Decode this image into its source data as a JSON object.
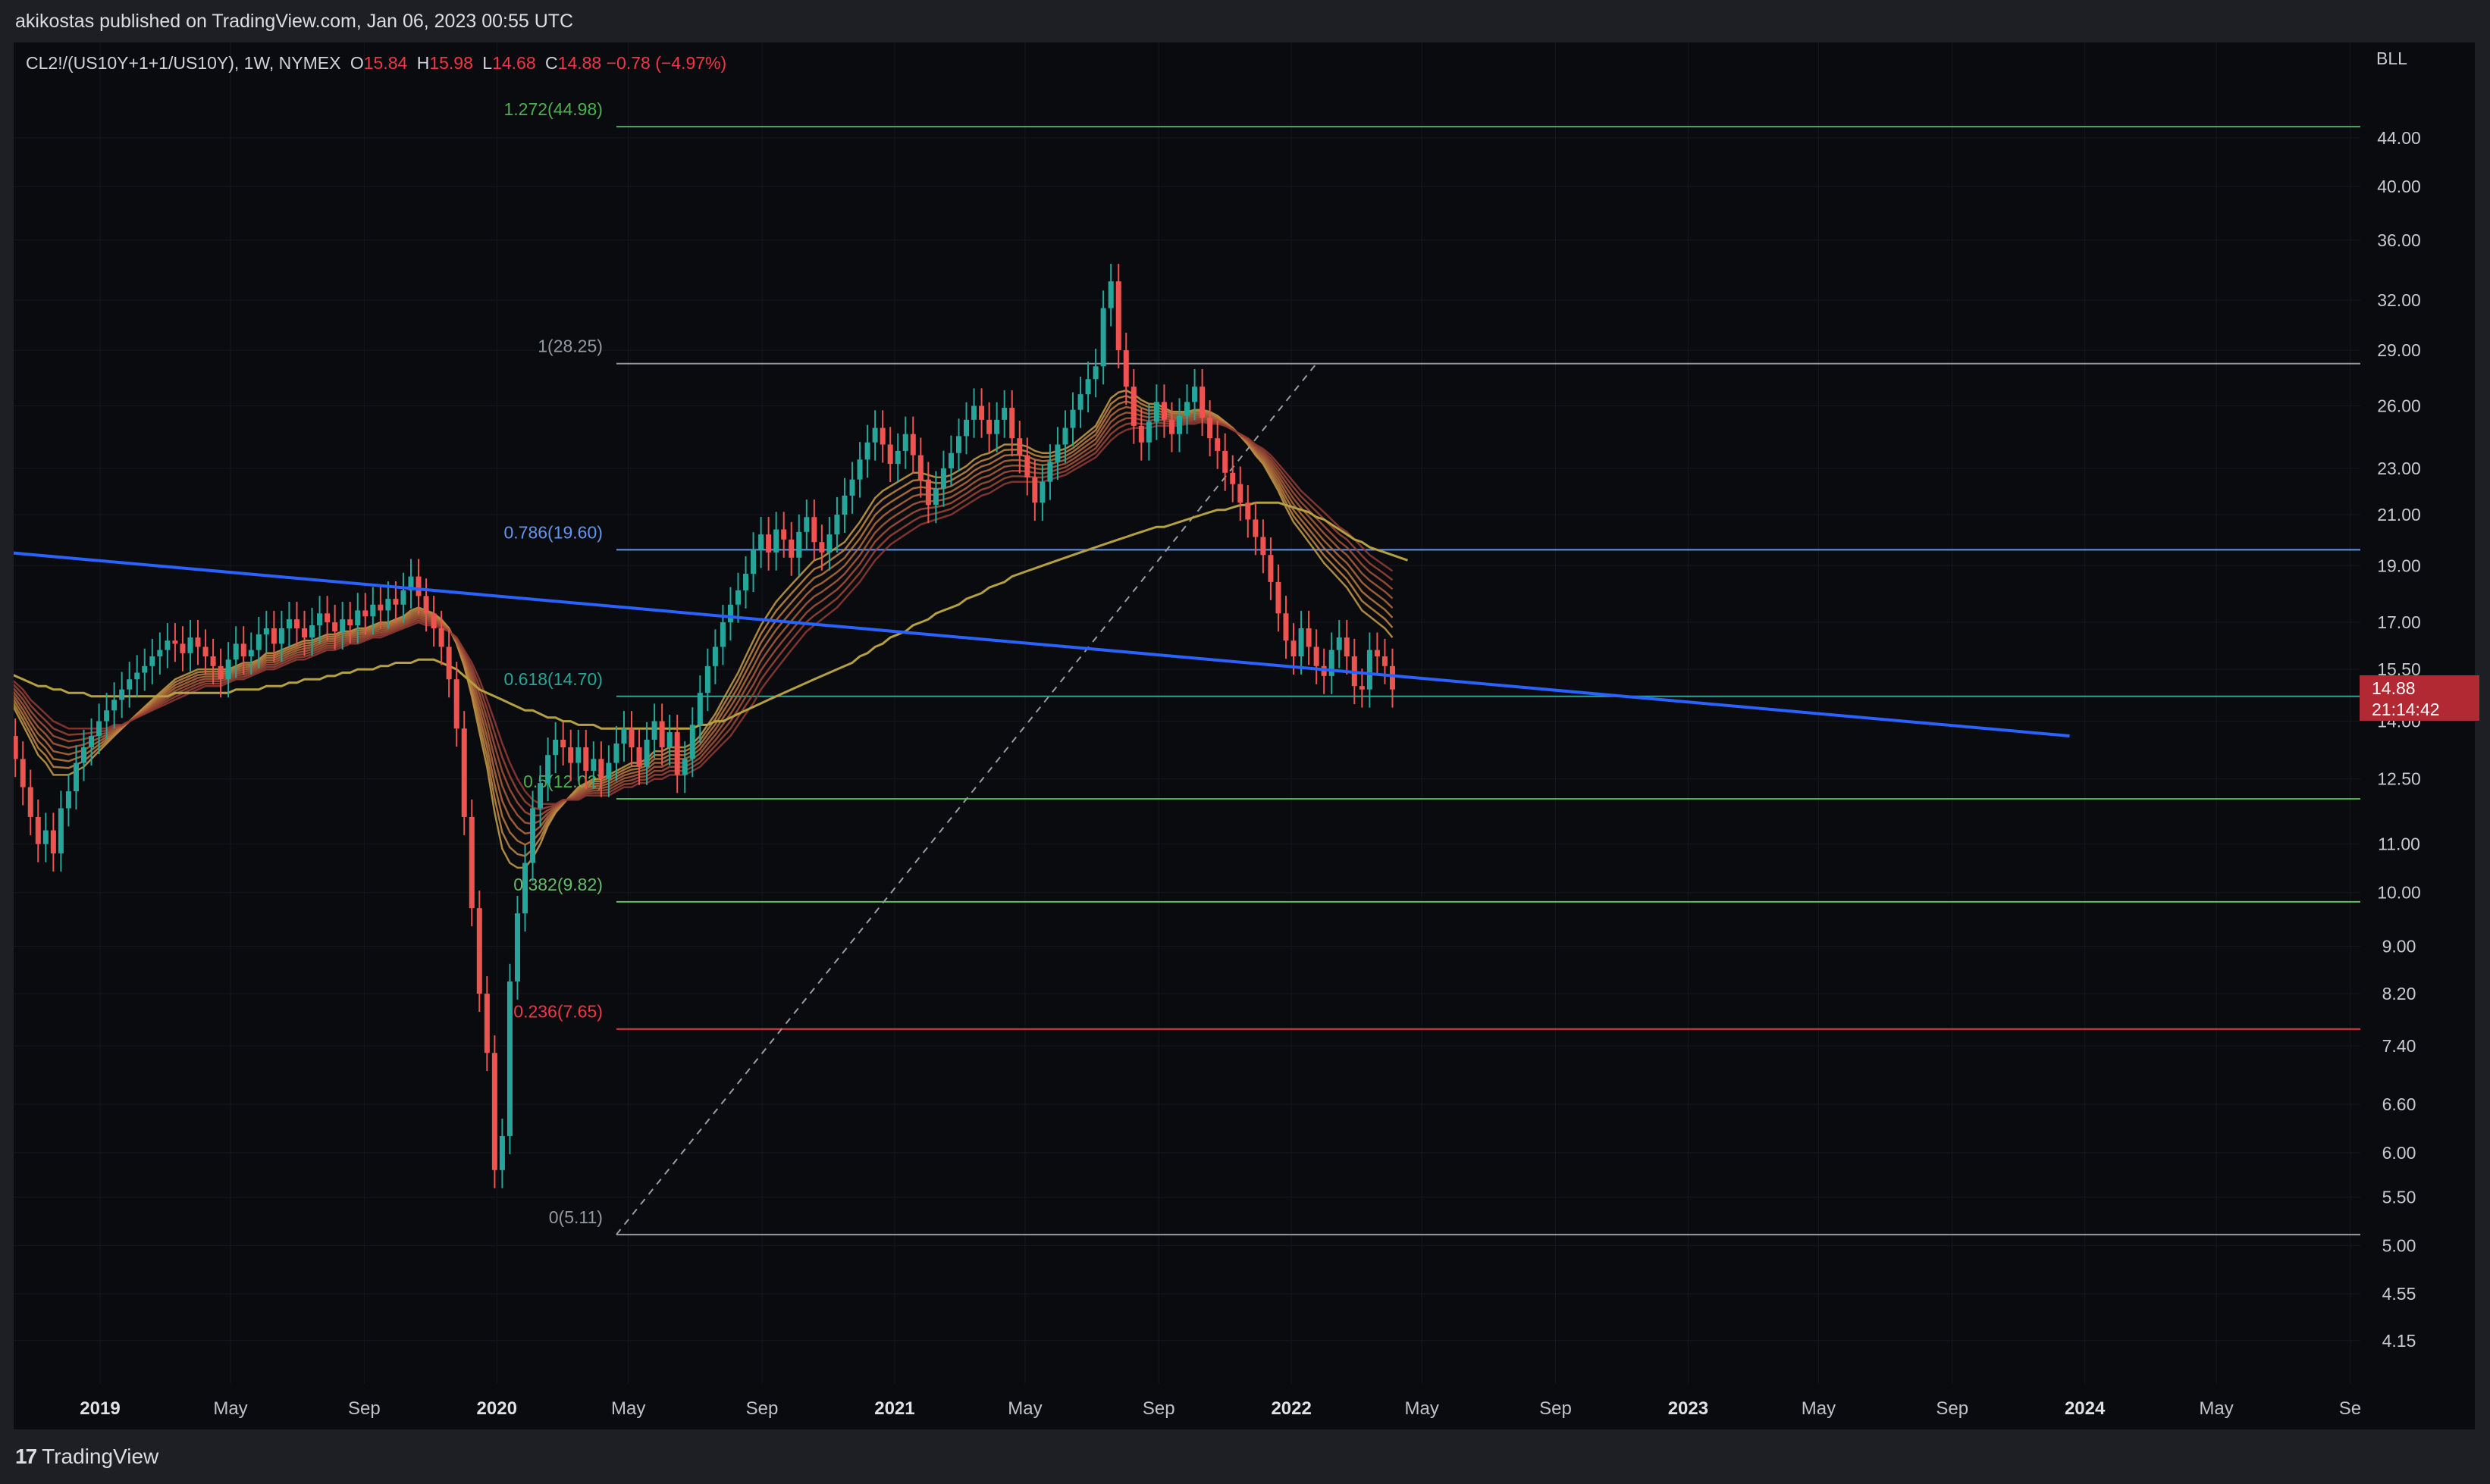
{
  "header": {
    "publisher_text": "akikostas published on TradingView.com, Jan 06, 2023 00:55 UTC"
  },
  "legend": {
    "symbol": "CL2!/(US10Y+1+1/US10Y), 1W, NYMEX",
    "o_label": "O",
    "o_value": "15.84",
    "h_label": "H",
    "h_value": "15.98",
    "l_label": "L",
    "l_value": "14.68",
    "c_label": "C",
    "c_value": "14.88",
    "change": "−0.78 (−4.97%)"
  },
  "currency_label": "BLL",
  "price_box": {
    "price": "14.88",
    "countdown": "21:14:42"
  },
  "footer": {
    "logo_mark": "17",
    "logo_text": "TradingView"
  },
  "colors": {
    "background": "#0a0b0f",
    "up": "#26a69a",
    "down": "#ef5350",
    "trendline": "#2962ff",
    "fib_green": "#4caf50",
    "fib_red": "#f23645",
    "fib_blue": "#6495ed",
    "fib_gray": "#9598a1"
  },
  "chart_data": {
    "type": "candlestick",
    "y_scale": "log",
    "ylim": [
      3.8,
      50
    ],
    "y_ticks": [
      "44.00",
      "40.00",
      "36.00",
      "32.00",
      "29.00",
      "26.00",
      "23.00",
      "21.00",
      "19.00",
      "17.00",
      "15.50",
      "14.00",
      "12.50",
      "11.00",
      "10.00",
      "9.00",
      "8.20",
      "7.40",
      "6.60",
      "6.00",
      "5.50",
      "5.00",
      "4.55",
      "4.15"
    ],
    "x_ticks": [
      {
        "label": "2019",
        "date": "2019-01-01",
        "bold": true
      },
      {
        "label": "May",
        "date": "2019-05-01",
        "bold": false
      },
      {
        "label": "Sep",
        "date": "2019-09-01",
        "bold": false
      },
      {
        "label": "2020",
        "date": "2020-01-01",
        "bold": true
      },
      {
        "label": "May",
        "date": "2020-05-01",
        "bold": false
      },
      {
        "label": "Sep",
        "date": "2020-09-01",
        "bold": false
      },
      {
        "label": "2021",
        "date": "2021-01-01",
        "bold": true
      },
      {
        "label": "May",
        "date": "2021-05-01",
        "bold": false
      },
      {
        "label": "Sep",
        "date": "2021-09-01",
        "bold": false
      },
      {
        "label": "2022",
        "date": "2022-01-01",
        "bold": true
      },
      {
        "label": "May",
        "date": "2022-05-01",
        "bold": false
      },
      {
        "label": "Sep",
        "date": "2022-09-01",
        "bold": false
      },
      {
        "label": "2023",
        "date": "2023-01-01",
        "bold": true
      },
      {
        "label": "May",
        "date": "2023-05-01",
        "bold": false
      },
      {
        "label": "Sep",
        "date": "2023-09-01",
        "bold": false
      },
      {
        "label": "2024",
        "date": "2024-01-01",
        "bold": true
      },
      {
        "label": "May",
        "date": "2024-05-01",
        "bold": false
      },
      {
        "label": "Se",
        "date": "2024-09-01",
        "bold": false
      }
    ],
    "fib_levels": [
      {
        "label": "1.272(44.98)",
        "value": 44.98,
        "color": "#4caf50"
      },
      {
        "label": "1(28.25)",
        "value": 28.25,
        "color": "#9598a1"
      },
      {
        "label": "0.786(19.60)",
        "value": 19.6,
        "color": "#6495ed"
      },
      {
        "label": "0.618(14.70)",
        "value": 14.7,
        "color": "#26a69a"
      },
      {
        "label": "0.5(12.02)",
        "value": 12.02,
        "color": "#4caf50"
      },
      {
        "label": "0.382(9.82)",
        "value": 9.82,
        "color": "#66bb6a"
      },
      {
        "label": "0.236(7.65)",
        "value": 7.65,
        "color": "#f23645"
      },
      {
        "label": "0(5.11)",
        "value": 5.11,
        "color": "#9598a1"
      }
    ],
    "fib_start_date": "2020-04-20",
    "fib_end_date": "2024-12-20",
    "fib_diagonal": {
      "from": {
        "date": "2020-04-20",
        "value": 5.11
      },
      "to": {
        "date": "2022-01-24",
        "value": 28.25
      }
    },
    "trendline": {
      "from": {
        "date": "2018-09-10",
        "value": 19.6
      },
      "to": {
        "date": "2023-12-18",
        "value": 13.6
      }
    },
    "candles": {
      "start_date": "2018-09-17",
      "close": [
        15.9,
        15.5,
        14.9,
        13.6,
        13.0,
        12.3,
        11.6,
        11.0,
        11.3,
        10.8,
        11.8,
        12.2,
        12.9,
        13.3,
        13.6,
        14.0,
        14.3,
        14.6,
        14.9,
        15.2,
        15.4,
        15.6,
        15.9,
        16.1,
        16.4,
        16.3,
        16.0,
        16.5,
        16.2,
        15.9,
        15.6,
        15.2,
        15.8,
        16.3,
        15.9,
        16.1,
        16.6,
        16.8,
        16.3,
        16.8,
        17.1,
        16.8,
        16.5,
        16.9,
        17.3,
        17.0,
        16.7,
        17.1,
        16.9,
        17.4,
        17.2,
        17.6,
        17.4,
        17.8,
        17.6,
        18.1,
        18.6,
        17.9,
        17.3,
        16.8,
        16.2,
        15.2,
        13.8,
        11.6,
        9.7,
        8.2,
        7.3,
        5.8,
        6.2,
        8.4,
        9.6,
        10.6,
        11.8,
        12.4,
        13.1,
        13.5,
        13.3,
        12.9,
        13.3,
        12.7,
        13.0,
        12.5,
        12.9,
        13.4,
        13.8,
        13.3,
        12.8,
        13.5,
        14.0,
        13.3,
        13.7,
        12.6,
        13.0,
        13.9,
        14.8,
        15.6,
        16.2,
        17.0,
        17.6,
        18.1,
        18.7,
        19.6,
        20.2,
        19.5,
        20.4,
        20.0,
        19.3,
        20.3,
        20.9,
        19.9,
        19.5,
        20.2,
        21.0,
        21.8,
        22.5,
        23.4,
        24.2,
        24.9,
        24.1,
        23.2,
        23.8,
        24.6,
        23.6,
        22.5,
        21.4,
        22.1,
        23.0,
        23.7,
        24.5,
        25.3,
        26.0,
        25.3,
        24.6,
        25.3,
        25.9,
        24.4,
        23.6,
        22.6,
        21.5,
        22.4,
        23.3,
        24.1,
        24.9,
        25.8,
        26.6,
        27.4,
        28.1,
        31.5,
        33.2,
        29.0,
        27.0,
        25.0,
        24.2,
        25.2,
        26.2,
        25.3,
        24.6,
        25.5,
        26.2,
        27.0,
        25.4,
        24.4,
        23.8,
        22.8,
        22.3,
        21.5,
        20.8,
        20.1,
        19.4,
        18.4,
        17.3,
        16.4,
        15.9,
        16.8,
        16.2,
        15.6,
        15.3,
        16.1,
        16.5,
        15.9,
        15.0,
        14.9,
        16.1,
        15.9,
        15.6,
        14.9
      ],
      "ema_fast": [
        15.6,
        15.4,
        15.1,
        14.7,
        14.3,
        13.9,
        13.5,
        13.1,
        12.9,
        12.6,
        12.6,
        12.6,
        12.7,
        12.8,
        13.0,
        13.2,
        13.4,
        13.6,
        13.8,
        14.0,
        14.2,
        14.4,
        14.6,
        14.8,
        15.0,
        15.2,
        15.3,
        15.4,
        15.5,
        15.5,
        15.5,
        15.5,
        15.5,
        15.6,
        15.7,
        15.7,
        15.8,
        16.0,
        16.0,
        16.1,
        16.2,
        16.3,
        16.4,
        16.4,
        16.5,
        16.6,
        16.6,
        16.7,
        16.7,
        16.8,
        16.8,
        16.9,
        17.0,
        17.0,
        17.1,
        17.2,
        17.4,
        17.5,
        17.4,
        17.3,
        17.1,
        16.8,
        16.3,
        15.6,
        14.7,
        13.7,
        12.8,
        11.7,
        10.9,
        10.6,
        10.5,
        10.5,
        10.7,
        11.0,
        11.4,
        11.7,
        11.9,
        12.1,
        12.3,
        12.4,
        12.5,
        12.5,
        12.6,
        12.7,
        12.8,
        12.9,
        12.9,
        13.0,
        13.2,
        13.2,
        13.3,
        13.3,
        13.3,
        13.4,
        13.6,
        13.9,
        14.2,
        14.6,
        15.0,
        15.4,
        15.9,
        16.4,
        16.9,
        17.3,
        17.7,
        18.0,
        18.3,
        18.6,
        18.9,
        19.2,
        19.3,
        19.5,
        19.7,
        19.9,
        20.3,
        20.7,
        21.2,
        21.7,
        22.0,
        22.2,
        22.4,
        22.6,
        22.8,
        22.8,
        22.7,
        22.6,
        22.6,
        22.7,
        22.9,
        23.1,
        23.4,
        23.6,
        23.7,
        23.9,
        24.1,
        24.1,
        24.1,
        24.0,
        23.8,
        23.7,
        23.7,
        23.8,
        23.9,
        24.1,
        24.4,
        24.7,
        25.0,
        25.7,
        26.4,
        26.7,
        26.8,
        26.6,
        26.3,
        26.1,
        26.1,
        25.9,
        25.7,
        25.7,
        25.7,
        25.8,
        25.8,
        25.7,
        25.5,
        25.2,
        24.9,
        24.5,
        24.1,
        23.6,
        23.2,
        22.6,
        22.0,
        21.3,
        20.7,
        20.3,
        19.9,
        19.5,
        19.1,
        18.8,
        18.5,
        18.2,
        17.8,
        17.4,
        17.2,
        17.0,
        16.8,
        16.5
      ],
      "ema_slow": [
        15.8,
        15.7,
        15.5,
        15.3,
        15.1,
        14.9,
        14.6,
        14.4,
        14.2,
        14.0,
        13.9,
        13.8,
        13.8,
        13.8,
        13.8,
        13.8,
        13.8,
        13.9,
        13.9,
        14.0,
        14.1,
        14.2,
        14.3,
        14.4,
        14.5,
        14.6,
        14.7,
        14.8,
        14.9,
        15.0,
        15.0,
        15.0,
        15.1,
        15.2,
        15.2,
        15.3,
        15.4,
        15.5,
        15.5,
        15.6,
        15.7,
        15.8,
        15.8,
        15.9,
        16.0,
        16.1,
        16.1,
        16.2,
        16.3,
        16.3,
        16.4,
        16.5,
        16.5,
        16.6,
        16.7,
        16.8,
        16.9,
        17.0,
        16.9,
        16.9,
        16.8,
        16.7,
        16.5,
        16.1,
        15.7,
        15.2,
        14.6,
        14.0,
        13.4,
        12.9,
        12.5,
        12.2,
        12.0,
        11.9,
        11.9,
        11.9,
        12.0,
        12.0,
        12.0,
        12.1,
        12.1,
        12.1,
        12.1,
        12.2,
        12.3,
        12.3,
        12.4,
        12.4,
        12.5,
        12.5,
        12.6,
        12.6,
        12.6,
        12.7,
        12.8,
        13.0,
        13.2,
        13.4,
        13.6,
        13.9,
        14.2,
        14.5,
        14.9,
        15.2,
        15.5,
        15.8,
        16.1,
        16.4,
        16.7,
        16.9,
        17.1,
        17.3,
        17.5,
        17.8,
        18.1,
        18.4,
        18.8,
        19.2,
        19.5,
        19.8,
        20.0,
        20.2,
        20.4,
        20.6,
        20.7,
        20.8,
        20.9,
        21.0,
        21.2,
        21.4,
        21.6,
        21.8,
        21.9,
        22.1,
        22.3,
        22.4,
        22.4,
        22.4,
        22.4,
        22.4,
        22.5,
        22.6,
        22.7,
        22.9,
        23.1,
        23.3,
        23.5,
        23.9,
        24.3,
        24.6,
        24.8,
        24.9,
        24.9,
        24.9,
        25.0,
        25.0,
        25.0,
        25.0,
        25.1,
        25.1,
        25.2,
        25.1,
        25.1,
        25.0,
        24.8,
        24.6,
        24.4,
        24.1,
        23.9,
        23.6,
        23.2,
        22.8,
        22.4,
        22.0,
        21.7,
        21.4,
        21.1,
        20.8,
        20.5,
        20.3,
        20.0,
        19.7,
        19.4,
        19.2,
        19.0,
        18.8
      ],
      "ma_long": [
        15.7,
        15.6,
        15.5,
        15.4,
        15.3,
        15.2,
        15.1,
        15.0,
        15.0,
        14.9,
        14.9,
        14.8,
        14.8,
        14.8,
        14.7,
        14.7,
        14.7,
        14.7,
        14.7,
        14.7,
        14.7,
        14.7,
        14.7,
        14.7,
        14.7,
        14.8,
        14.8,
        14.8,
        14.8,
        14.8,
        14.8,
        14.8,
        14.8,
        14.9,
        14.9,
        14.9,
        14.9,
        15.0,
        15.0,
        15.0,
        15.1,
        15.1,
        15.2,
        15.2,
        15.2,
        15.3,
        15.3,
        15.4,
        15.4,
        15.5,
        15.5,
        15.5,
        15.6,
        15.6,
        15.7,
        15.7,
        15.7,
        15.8,
        15.8,
        15.8,
        15.7,
        15.6,
        15.5,
        15.3,
        15.1,
        14.9,
        14.8,
        14.7,
        14.6,
        14.5,
        14.4,
        14.3,
        14.3,
        14.2,
        14.1,
        14.1,
        14.0,
        14.0,
        13.9,
        13.9,
        13.9,
        13.8,
        13.8,
        13.8,
        13.8,
        13.8,
        13.8,
        13.8,
        13.8,
        13.8,
        13.8,
        13.8,
        13.8,
        13.8,
        13.9,
        13.9,
        14.0,
        14.0,
        14.1,
        14.2,
        14.3,
        14.4,
        14.5,
        14.6,
        14.7,
        14.8,
        14.9,
        15.0,
        15.1,
        15.2,
        15.3,
        15.4,
        15.5,
        15.6,
        15.7,
        15.9,
        16.0,
        16.2,
        16.3,
        16.5,
        16.6,
        16.7,
        16.9,
        17.0,
        17.1,
        17.3,
        17.4,
        17.5,
        17.6,
        17.8,
        17.9,
        18.0,
        18.2,
        18.3,
        18.4,
        18.6,
        18.7,
        18.8,
        18.9,
        19.0,
        19.1,
        19.2,
        19.3,
        19.4,
        19.5,
        19.6,
        19.7,
        19.8,
        19.9,
        20.0,
        20.1,
        20.2,
        20.3,
        20.4,
        20.5,
        20.5,
        20.6,
        20.7,
        20.8,
        20.9,
        21.0,
        21.1,
        21.2,
        21.2,
        21.3,
        21.4,
        21.4,
        21.5,
        21.5,
        21.5,
        21.5,
        21.4,
        21.3,
        21.2,
        21.1,
        20.9,
        20.8,
        20.6,
        20.4,
        20.2,
        20.0,
        19.9,
        19.7,
        19.6,
        19.5,
        19.4,
        19.3,
        19.2
      ]
    }
  }
}
